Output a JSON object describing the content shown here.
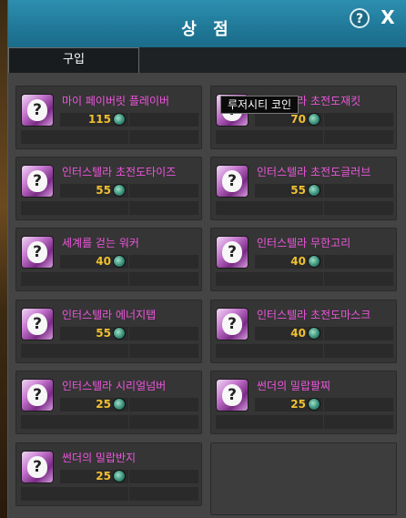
{
  "window": {
    "title": "상 점",
    "help_label": "?",
    "close_label": "X"
  },
  "tabs": [
    {
      "label": "구입",
      "active": true
    }
  ],
  "items": [
    {
      "name": "마이 페이버릿 플레이버",
      "price": "115",
      "icon": "mystery-box-icon"
    },
    {
      "name": "인터스텔라 초전도재킷",
      "price": "70",
      "icon": "mystery-box-icon"
    },
    {
      "name": "인터스텔라 초전도타이즈",
      "price": "55",
      "icon": "mystery-box-icon"
    },
    {
      "name": "인터스텔라 초전도글러브",
      "price": "55",
      "icon": "mystery-box-icon"
    },
    {
      "name": "세계를 걷는 워커",
      "price": "40",
      "icon": "mystery-box-icon"
    },
    {
      "name": "인터스텔라 무한고리",
      "price": "40",
      "icon": "mystery-box-icon"
    },
    {
      "name": "인터스텔라 에너지탭",
      "price": "55",
      "icon": "mystery-box-icon"
    },
    {
      "name": "인터스텔라 초전도마스크",
      "price": "40",
      "icon": "mystery-box-icon"
    },
    {
      "name": "인터스텔라 시리얼넘버",
      "price": "25",
      "icon": "mystery-box-icon"
    },
    {
      "name": "썬더의 밀랍팔찌",
      "price": "25",
      "icon": "mystery-box-icon"
    },
    {
      "name": "썬더의 밀랍반지",
      "price": "25",
      "icon": "mystery-box-icon"
    }
  ],
  "currency": {
    "icon": "coin-icon"
  },
  "tooltip": {
    "text": "루저시티 코인"
  },
  "colors": {
    "header": "#1f7695",
    "item_name": "#ee55dd",
    "price": "#f0c030"
  }
}
